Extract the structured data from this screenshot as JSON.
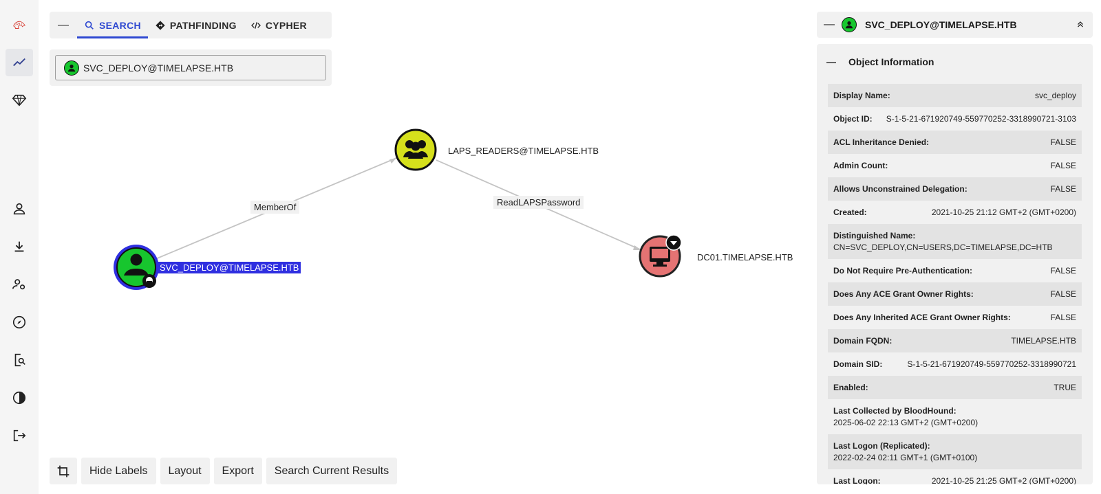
{
  "nav": {
    "items": [
      {
        "name": "logo-icon"
      },
      {
        "name": "explore-icon",
        "active": true
      },
      {
        "name": "gem-icon"
      },
      {
        "name": "user-icon"
      },
      {
        "name": "download-icon"
      },
      {
        "name": "user-settings-icon"
      },
      {
        "name": "compass-icon"
      },
      {
        "name": "file-search-icon"
      },
      {
        "name": "theme-toggle-icon"
      },
      {
        "name": "logout-icon"
      }
    ]
  },
  "search": {
    "collapse": "—",
    "tabs": {
      "search": "SEARCH",
      "pathfinding": "PATHFINDING",
      "cypher": "CYPHER"
    },
    "value": "SVC_DEPLOY@TIMELAPSE.HTB"
  },
  "graph": {
    "nodes": {
      "svc": {
        "label": "SVC_DEPLOY@TIMELAPSE.HTB",
        "color": "#17c62e"
      },
      "laps": {
        "label": "LAPS_READERS@TIMELAPSE.HTB",
        "color": "#d6e01c"
      },
      "dc": {
        "label": "DC01.TIMELAPSE.HTB",
        "color": "#e57373"
      }
    },
    "edges": {
      "memberof": "MemberOf",
      "readlaps": "ReadLAPSPassword"
    }
  },
  "toolbar": {
    "hide_labels": "Hide Labels",
    "layout": "Layout",
    "export": "Export",
    "search_results": "Search Current Results"
  },
  "entity": {
    "title": "SVC_DEPLOY@TIMELAPSE.HTB",
    "section": "Object Information",
    "rows": [
      {
        "k": "Display Name:",
        "v": "svc_deploy"
      },
      {
        "k": "Object ID:",
        "v": "S-1-5-21-671920749-559770252-3318990721-3103"
      },
      {
        "k": "ACL Inheritance Denied:",
        "v": "FALSE"
      },
      {
        "k": "Admin Count:",
        "v": "FALSE"
      },
      {
        "k": "Allows Unconstrained Delegation:",
        "v": "FALSE"
      },
      {
        "k": "Created:",
        "v": "2021-10-25 21:12 GMT+2 (GMT+0200)"
      },
      {
        "k": "Distinguished Name:",
        "v": "CN=SVC_DEPLOY,CN=USERS,DC=TIMELAPSE,DC=HTB"
      },
      {
        "k": "Do Not Require Pre-Authentication:",
        "v": "FALSE"
      },
      {
        "k": "Does Any ACE Grant Owner Rights:",
        "v": "FALSE"
      },
      {
        "k": "Does Any Inherited ACE Grant Owner Rights:",
        "v": "FALSE"
      },
      {
        "k": "Domain FQDN:",
        "v": "TIMELAPSE.HTB"
      },
      {
        "k": "Domain SID:",
        "v": "S-1-5-21-671920749-559770252-3318990721"
      },
      {
        "k": "Enabled:",
        "v": "TRUE"
      },
      {
        "k": "Last Collected by BloodHound:",
        "v": "2025-06-02 22:13 GMT+2 (GMT+0200)"
      },
      {
        "k": "Last Logon (Replicated):",
        "v": "2022-02-24 02:11 GMT+1 (GMT+0100)"
      },
      {
        "k": "Last Logon:",
        "v": "2021-10-25 21:25 GMT+2 (GMT+0200)"
      }
    ]
  }
}
